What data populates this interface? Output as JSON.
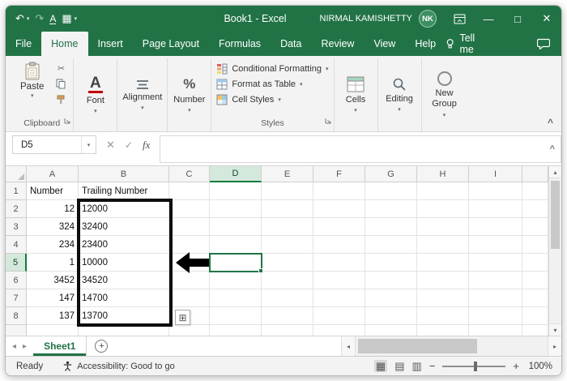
{
  "titlebar": {
    "title": "Book1 - Excel",
    "user_name": "NIRMAL KAMISHETTY",
    "user_initials": "NK"
  },
  "ribbon_tabs": {
    "items": [
      "File",
      "Home",
      "Insert",
      "Page Layout",
      "Formulas",
      "Data",
      "Review",
      "View",
      "Help"
    ],
    "active": "Home",
    "tell_me": "Tell me"
  },
  "ribbon": {
    "paste": "Paste",
    "clipboard_label": "Clipboard",
    "font": "Font",
    "alignment": "Alignment",
    "number": "Number",
    "styles_items": [
      "Conditional Formatting",
      "Format as Table",
      "Cell Styles"
    ],
    "styles_label": "Styles",
    "cells": "Cells",
    "editing": "Editing",
    "new_group": "New Group"
  },
  "formula_bar": {
    "name_box": "D5",
    "fx_label": "fx"
  },
  "sheet": {
    "columns": [
      "A",
      "B",
      "C",
      "D",
      "E",
      "F",
      "G",
      "H",
      "I"
    ],
    "rows": [
      {
        "n": "1",
        "A": "Number",
        "B": "Trailing Number"
      },
      {
        "n": "2",
        "A": "12",
        "B": "12000"
      },
      {
        "n": "3",
        "A": "324",
        "B": "32400"
      },
      {
        "n": "4",
        "A": "234",
        "B": "23400"
      },
      {
        "n": "5",
        "A": "1",
        "B": "10000"
      },
      {
        "n": "6",
        "A": "3452",
        "B": "34520"
      },
      {
        "n": "7",
        "A": "147",
        "B": "14700"
      },
      {
        "n": "8",
        "A": "137",
        "B": "13700"
      }
    ],
    "selected_cell": "D5",
    "active_sheet": "Sheet1"
  },
  "status_bar": {
    "mode": "Ready",
    "accessibility": "Accessibility: Good to go",
    "zoom": "100%"
  },
  "colors": {
    "excel_green": "#217346",
    "annotation_black": "#0d0d0d",
    "selection_green": "#107c41"
  }
}
